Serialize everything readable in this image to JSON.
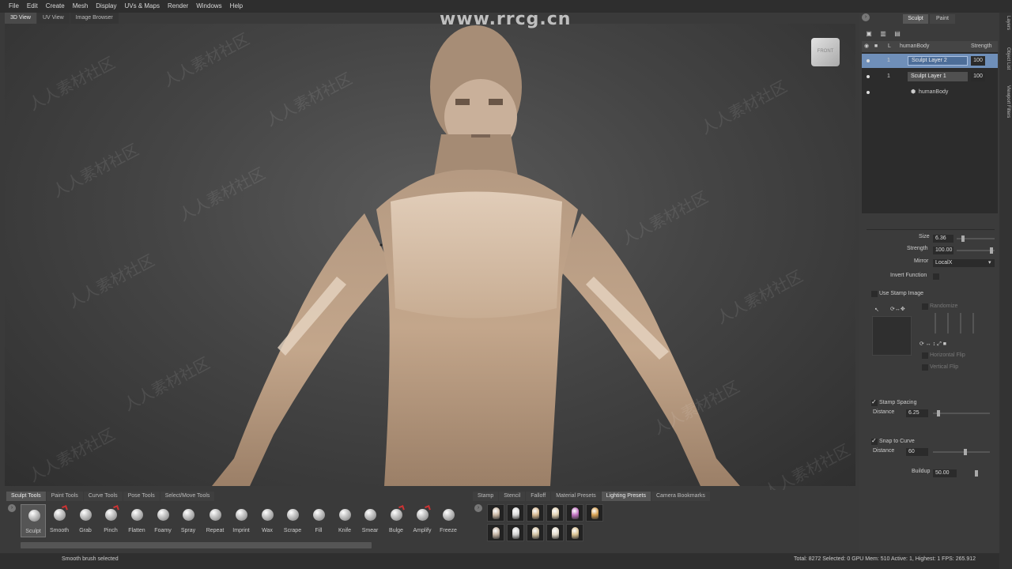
{
  "menu": [
    "File",
    "Edit",
    "Create",
    "Mesh",
    "Display",
    "UVs & Maps",
    "Render",
    "Windows",
    "Help"
  ],
  "view_tabs": [
    "3D View",
    "UV View",
    "Image Browser"
  ],
  "viewcube_label": "FRONT",
  "watermark_top": "www.rrcg.cn",
  "watermark_repeat": "人人素材社区",
  "right_panel": {
    "mode_tabs": [
      "Sculpt",
      "Paint"
    ],
    "layers_header": {
      "name": "humanBody",
      "strength": "Strength"
    },
    "layers": [
      {
        "name": "Sculpt Layer 2",
        "level": "1",
        "strength": "100",
        "selected": true
      },
      {
        "name": "Sculpt Layer 1",
        "level": "1",
        "strength": "100",
        "selected": false
      },
      {
        "name": "humanBody",
        "level": "",
        "strength": "",
        "selected": false
      }
    ],
    "side_tabs": [
      "Layers",
      "Object List",
      "Viewport Filters"
    ],
    "size_label": "Size",
    "size_value": "6.36",
    "strength_label": "Strength",
    "strength_value": "100.00",
    "mirror_label": "Mirror",
    "mirror_value": "LocalX",
    "invert_label": "Invert Function",
    "stamp_image_label": "Use Stamp Image",
    "randomize_label": "Randomize",
    "horizontal_flip_label": "Horizontal Flip",
    "vertical_flip_label": "Vertical Flip",
    "stamp_spacing_label": "Stamp Spacing",
    "distance_label": "Distance",
    "distance_value": "6.25",
    "snap_curve_label": "Snap to Curve",
    "distance2_label": "Distance",
    "distance2_value": "60",
    "buildup_label": "Buildup",
    "buildup_value": "50.00"
  },
  "tray": {
    "tool_tabs": [
      "Sculpt Tools",
      "Paint Tools",
      "Curve Tools",
      "Pose Tools",
      "Select/Move Tools"
    ],
    "tools": [
      "Sculpt",
      "Smooth",
      "Grab",
      "Pinch",
      "Flatten",
      "Foamy",
      "Spray",
      "Repeat",
      "Imprint",
      "Wax",
      "Scrape",
      "Fill",
      "Knife",
      "Smear",
      "Bulge",
      "Amplify",
      "Freeze"
    ],
    "preset_tabs": [
      "Stamp",
      "Stencil",
      "Falloff",
      "Material Presets",
      "Lighting Presets",
      "Camera Bookmarks"
    ],
    "preset_colors": [
      "#c9b6a3",
      "#d8d8d8",
      "#d6b890",
      "#e0d0b0",
      "#c070c0",
      "#d6a050",
      "#c0b0a0",
      "#cfcfcf",
      "#d0c0a0",
      "#e0d8c8",
      "#d8c090"
    ]
  },
  "status": {
    "message": "Smooth brush selected",
    "stats": "Total: 8272  Selected: 0 GPU Mem: 510  Active: 1, Highest: 1  FPS: 265.912"
  }
}
